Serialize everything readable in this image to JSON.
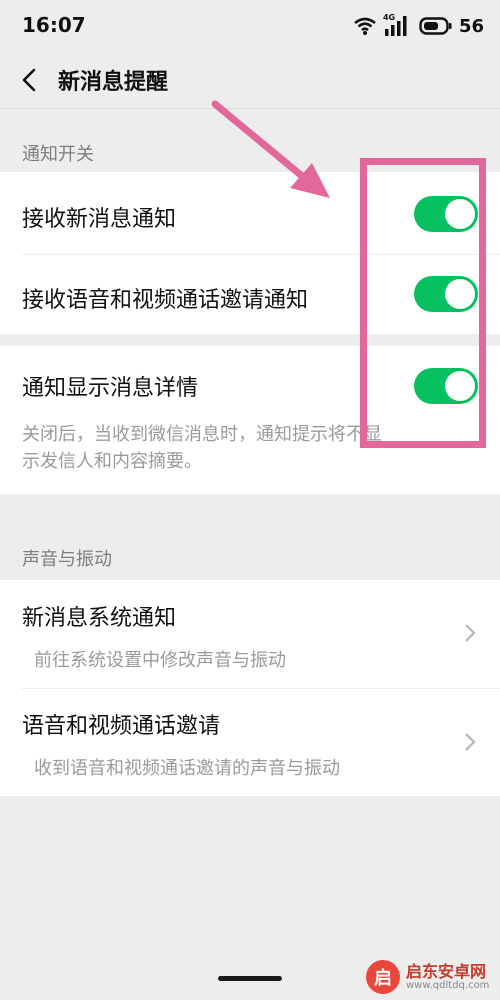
{
  "status_bar": {
    "time": "16:07",
    "network_label": "4G",
    "battery": "56",
    "icons": [
      "wifi-icon",
      "signal-icon",
      "battery-icon"
    ]
  },
  "nav": {
    "title": "新消息提醒",
    "back_icon": "chevron-left-icon"
  },
  "notification_section": {
    "label": "通知开关",
    "items": [
      {
        "title": "接收新消息通知",
        "on": true
      },
      {
        "title": "接收语音和视频通话邀请通知",
        "on": true
      }
    ]
  },
  "detail_item": {
    "title": "通知显示消息详情",
    "on": true,
    "description_line1": "关闭后，当收到微信消息时，通知提示将不显",
    "description_line2": "示发信人和内容摘要。"
  },
  "sound_section": {
    "label": "声音与振动",
    "items": [
      {
        "title": "新消息系统通知",
        "subtitle": "前往系统设置中修改声音与振动"
      },
      {
        "title": "语音和视频通话邀请",
        "subtitle": "收到语音和视频通话邀请的声音与振动"
      }
    ]
  },
  "annotation": {
    "color": "#e2679a"
  },
  "watermark": {
    "logo_char": "启",
    "name": "启东安卓网",
    "url": "www.qdltdq.com"
  },
  "colors": {
    "toggle_on": "#07c160",
    "background": "#ededed"
  }
}
